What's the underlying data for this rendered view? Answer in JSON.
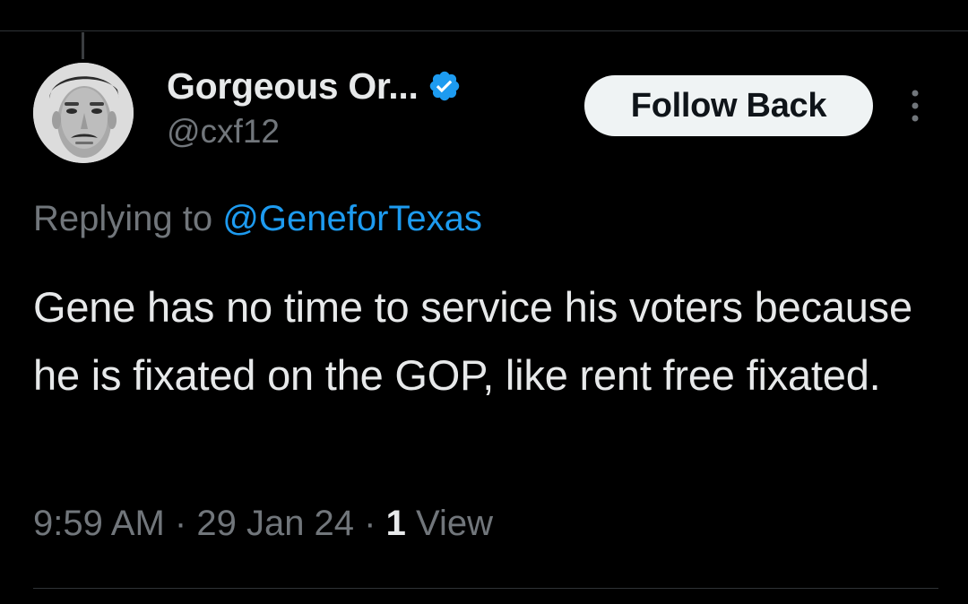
{
  "tweet": {
    "author": {
      "display_name": "Gorgeous Or...",
      "handle": "@cxf12",
      "verified": true,
      "avatar_icon": "profile-photo"
    },
    "follow_button_label": "Follow Back",
    "more_icon": "more-vertical-icon",
    "replying_to_label": "Replying to",
    "replying_to_handle": "@GeneforTexas",
    "text": "Gene has no time to service his voters because he is fixated on the GOP, like rent free fixated.",
    "time": "9:59 AM",
    "date": "29 Jan 24",
    "separator": "·",
    "view_count": "1",
    "view_label": "View"
  },
  "colors": {
    "background": "#000000",
    "primary_text": "#e7e9ea",
    "secondary_text": "#71767b",
    "accent": "#1d9bf0",
    "button_bg": "#eff3f4",
    "button_text": "#0f1419",
    "divider": "#2f3336"
  }
}
